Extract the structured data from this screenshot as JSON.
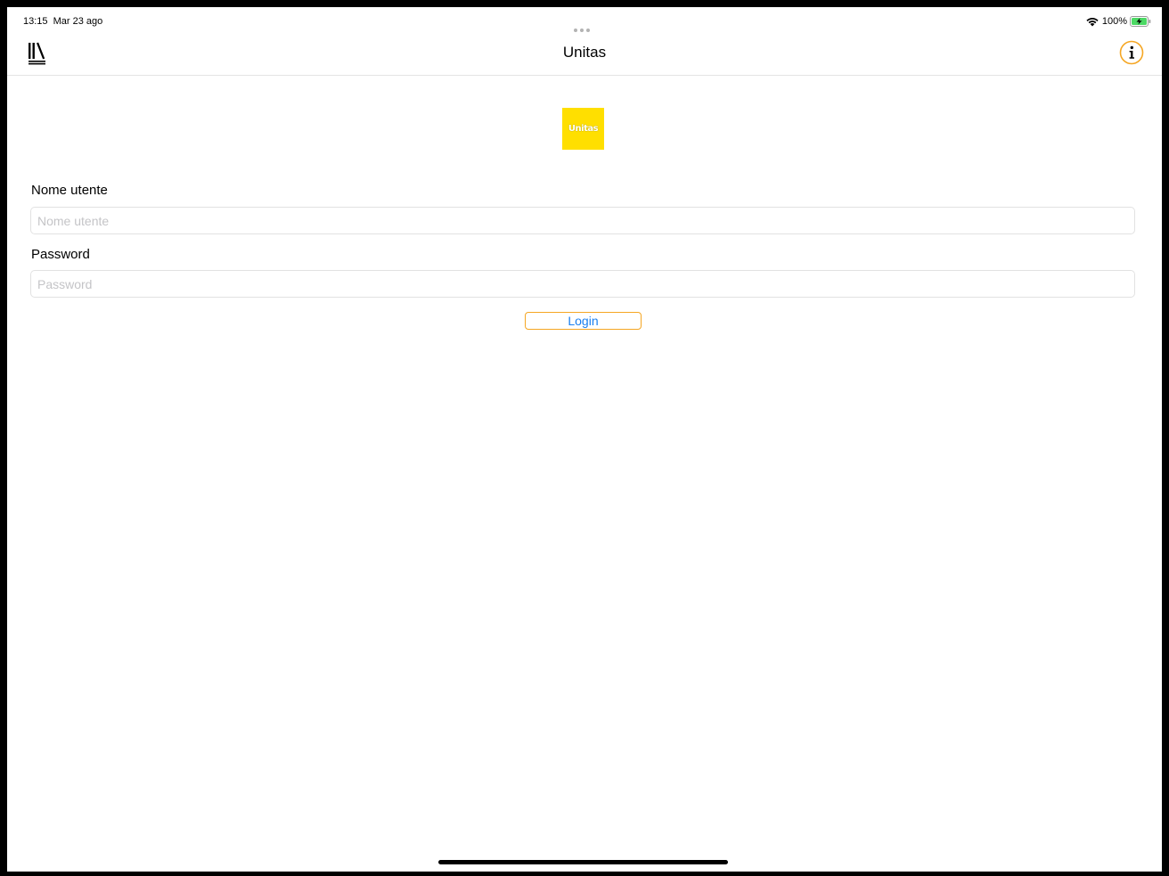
{
  "status_bar": {
    "time": "13:15  Mar 23 ago",
    "battery_percent": "100%",
    "icons": [
      "wifi-icon",
      "battery-charging-icon"
    ]
  },
  "nav_bar": {
    "title": "Unitas",
    "left_icon": "library-icon",
    "right_icon": "info-icon",
    "accent_color": "#f5a623"
  },
  "logo": {
    "text": "Unitas",
    "background": "#ffdf00"
  },
  "form": {
    "username_label": "Nome utente",
    "username_placeholder": "Nome utente",
    "username_value": "",
    "password_label": "Password",
    "password_placeholder": "Password",
    "password_value": "",
    "login_label": "Login",
    "login_text_color": "#1a7ff0",
    "login_border_color": "#f5a623"
  }
}
